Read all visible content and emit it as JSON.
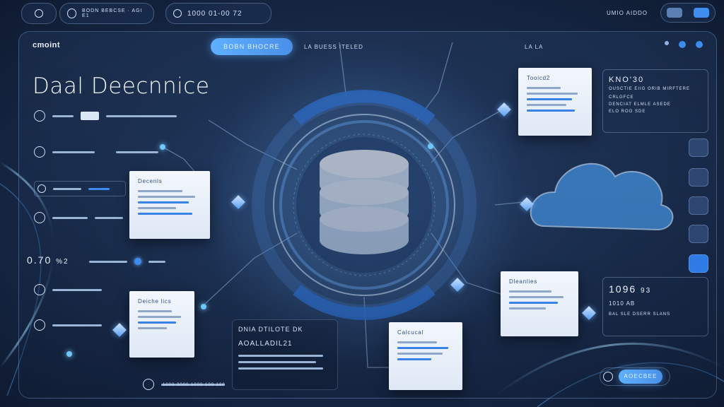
{
  "topbar": {
    "nav_text": "BODN BEBCSE · AGI E1",
    "time_text": "1000 01-00 72",
    "right_label": "UMIO AIDDO"
  },
  "header": {
    "logo": "cmoint",
    "cta_label": "BOBN BHOCRE",
    "sub_label": "LA BUESS ITELED",
    "right_tiny": "LA LA"
  },
  "page": {
    "title": "Daal Deecnnice"
  },
  "left_panel": {
    "stat_value": "0.70",
    "stat_suffix": "%2"
  },
  "docs": [
    {
      "title": "Tooicd2"
    },
    {
      "title": "Decenls"
    },
    {
      "title": "Deiche lics"
    },
    {
      "title": "Calcucal"
    },
    {
      "title": "Dleanlies"
    }
  ],
  "right_panel": {
    "head": "KNO'30",
    "line1": "OUSCTIE EIIG ORIB MIRFTERE",
    "line2": "CRLGFCE",
    "line3": "DENCIAT ELMLE ASEDE",
    "line4": "ELO ROO SDE",
    "num2": "1096",
    "num2_suffix": "93",
    "line5": "1010 AB",
    "line6": "BAL SLE DSERR SLANS"
  },
  "bottom_panel": {
    "head": "DNIA DTILOTE DK",
    "subhead": "AOALLADIL21",
    "footer": "1000 3000 1000 100 100"
  },
  "bottom_right": {
    "button_label": "AOECBEE"
  }
}
